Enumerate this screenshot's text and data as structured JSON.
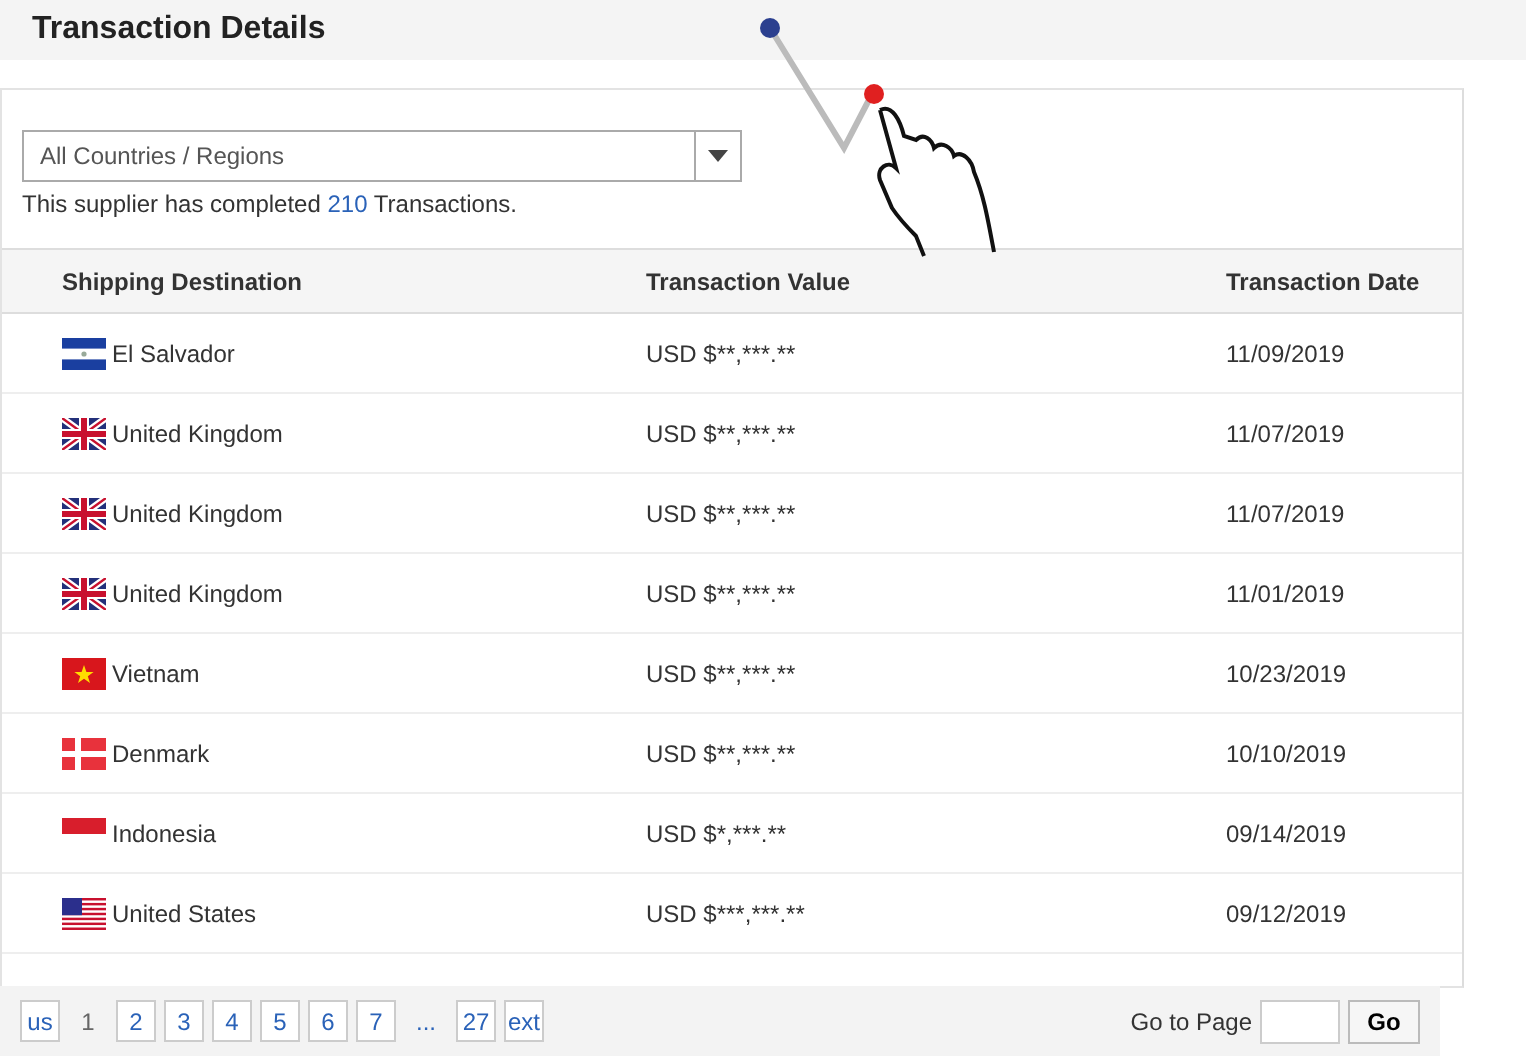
{
  "title": "Transaction Details",
  "filter": {
    "value": "All Countries / Regions"
  },
  "summary": "This supplier has completed **210** Transactions.",
  "table": {
    "columns": [
      "Shipping Destination",
      "Transaction Value",
      "Transaction Date"
    ],
    "rows": [
      {
        "kind": "sv",
        "country": "El Salvador",
        "value": "USD $**,***.**",
        "date": "11/09/2019"
      },
      {
        "kind": "gb",
        "country": "United Kingdom",
        "value": "USD $**,***.**",
        "date": "11/07/2019"
      },
      {
        "kind": "gb",
        "country": "United Kingdom",
        "value": "USD $**,***.**",
        "date": "11/07/2019"
      },
      {
        "kind": "gb",
        "country": "United Kingdom",
        "value": "USD $**,***.**",
        "date": "11/01/2019"
      },
      {
        "kind": "vn",
        "country": "Vietnam",
        "value": "USD $**,***.**",
        "date": "10/23/2019"
      },
      {
        "kind": "dk",
        "country": "Denmark",
        "value": "USD $**,***.**",
        "date": "10/10/2019"
      },
      {
        "kind": "id",
        "country": "Indonesia",
        "value": "USD $*,***.**",
        "date": "09/14/2019"
      },
      {
        "kind": "us",
        "country": "United States",
        "value": "USD $***,***.**",
        "date": "09/12/2019"
      }
    ]
  },
  "pagination": {
    "pages": [
      {
        "label": "us",
        "kind": "nav",
        "selected": false
      },
      {
        "label": "1",
        "kind": "page",
        "selected": true
      },
      {
        "label": "2",
        "kind": "page",
        "selected": false
      },
      {
        "label": "3",
        "kind": "page",
        "selected": false
      },
      {
        "label": "4",
        "kind": "page",
        "selected": false
      },
      {
        "label": "5",
        "kind": "page",
        "selected": false
      },
      {
        "label": "6",
        "kind": "page",
        "selected": false
      },
      {
        "label": "7",
        "kind": "page",
        "selected": false
      },
      {
        "label": "...",
        "kind": "gap",
        "selected": false
      },
      {
        "label": "27",
        "kind": "page",
        "selected": false
      },
      {
        "label": "ext",
        "kind": "nav",
        "selected": false
      }
    ],
    "goto_label": "Go to Page",
    "go_button": "Go"
  }
}
